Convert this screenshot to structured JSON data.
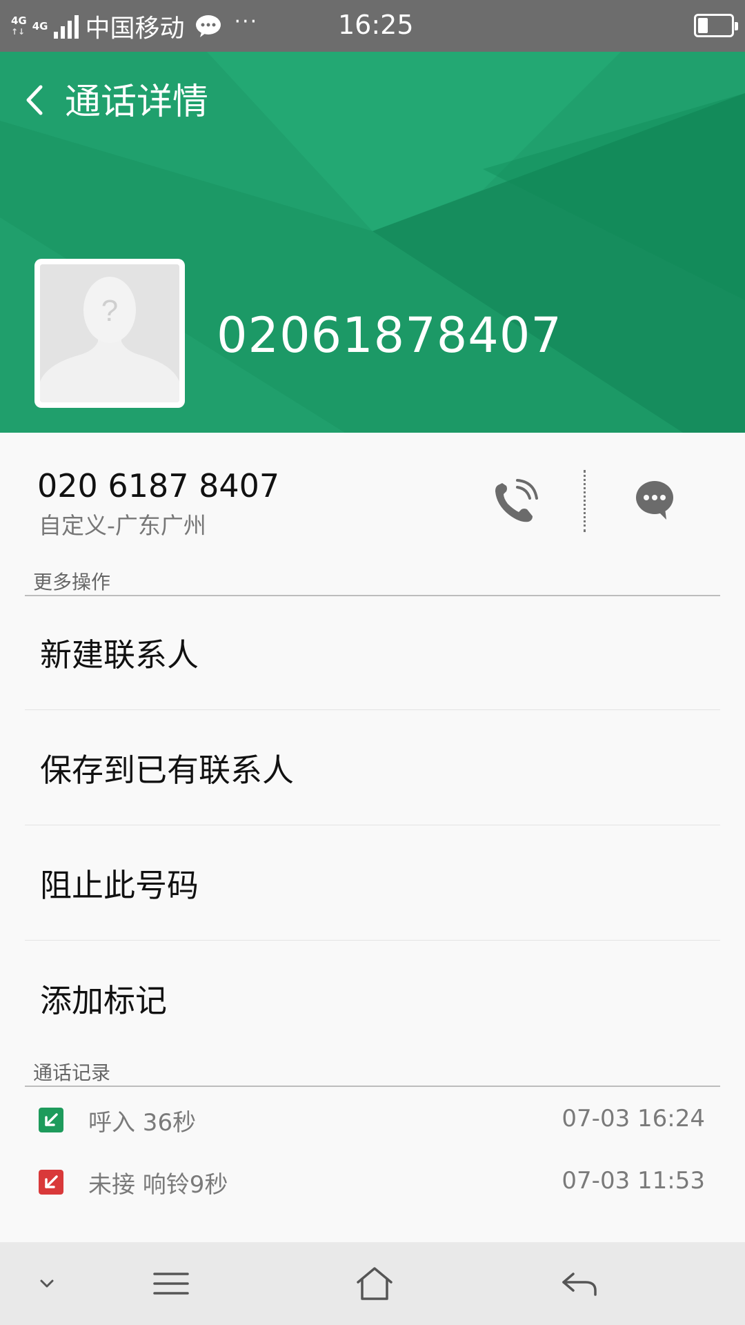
{
  "status_bar": {
    "network_top": "4G",
    "network_bottom": "4G",
    "carrier": "中国移动",
    "dots": "···",
    "time": "16:25",
    "battery_level": 0.3
  },
  "header": {
    "title": "通话详情",
    "number": "02061878407",
    "color": "#1e9b68"
  },
  "contact": {
    "formatted_number": "020 6187 8407",
    "location": "自定义-广东广州"
  },
  "more_actions": {
    "label": "更多操作",
    "items": [
      "新建联系人",
      "保存到已有联系人",
      "阻止此号码",
      "添加标记"
    ]
  },
  "call_log": {
    "label": "通话记录",
    "entries": [
      {
        "type": "incoming",
        "text": "呼入 36秒",
        "time": "07-03 16:24",
        "color": "#1e9b5c"
      },
      {
        "type": "missed",
        "text": "未接 响铃9秒",
        "time": "07-03 11:53",
        "color": "#d9393a"
      }
    ]
  },
  "icons": {
    "back": "chevron-left-icon",
    "call": "phone-icon",
    "sms": "message-icon",
    "nav": [
      "chevron-down-icon",
      "menu-icon",
      "home-icon",
      "back-arrow-icon"
    ]
  }
}
